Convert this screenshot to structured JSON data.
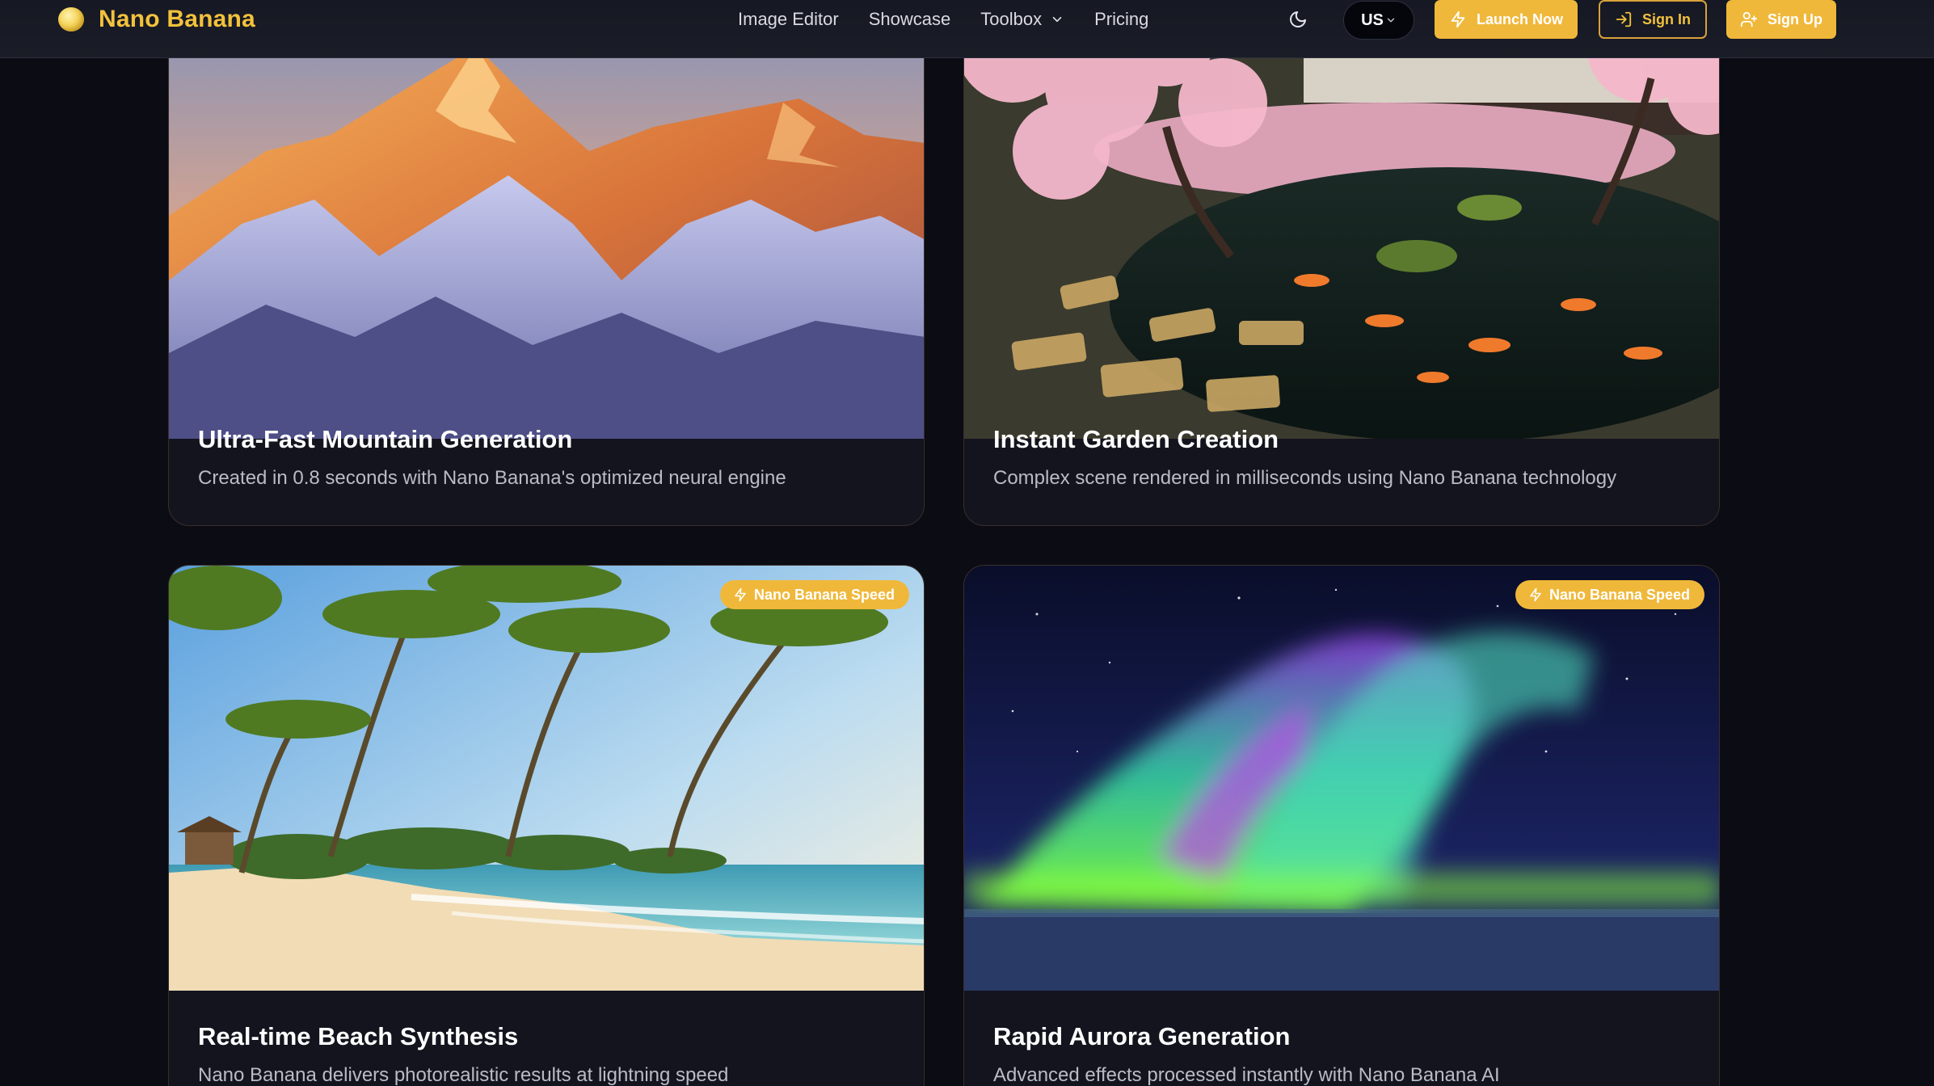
{
  "header": {
    "brand": "Nano Banana",
    "nav": [
      {
        "label": "Image Editor"
      },
      {
        "label": "Showcase"
      },
      {
        "label": "Toolbox"
      },
      {
        "label": "Pricing"
      }
    ],
    "language": "US",
    "buttons": {
      "launch": "Launch Now",
      "sign_in": "Sign In",
      "sign_up": "Sign Up"
    }
  },
  "cards": [
    {
      "title": "Ultra-Fast Mountain Generation",
      "description": "Created in 0.8 seconds with Nano Banana's optimized neural engine"
    },
    {
      "title": "Instant Garden Creation",
      "description": "Complex scene rendered in milliseconds using Nano Banana technology"
    },
    {
      "title": "Real-time Beach Synthesis",
      "description": "Nano Banana delivers photorealistic results at lightning speed",
      "badge": "Nano Banana Speed"
    },
    {
      "title": "Rapid Aurora Generation",
      "description": "Advanced effects processed instantly with Nano Banana AI",
      "badge": "Nano Banana Speed"
    }
  ],
  "colors": {
    "accent": "#f0b83a",
    "brand_text": "#f2c23c",
    "background": "#0c0c14",
    "card": "#13141e"
  },
  "icons": {
    "logo": "banana-logo-icon",
    "theme": "moon-icon",
    "launch": "lightning-icon",
    "sign_in": "login-icon",
    "sign_up": "user-plus-icon",
    "dropdown": "chevron-down-icon"
  }
}
